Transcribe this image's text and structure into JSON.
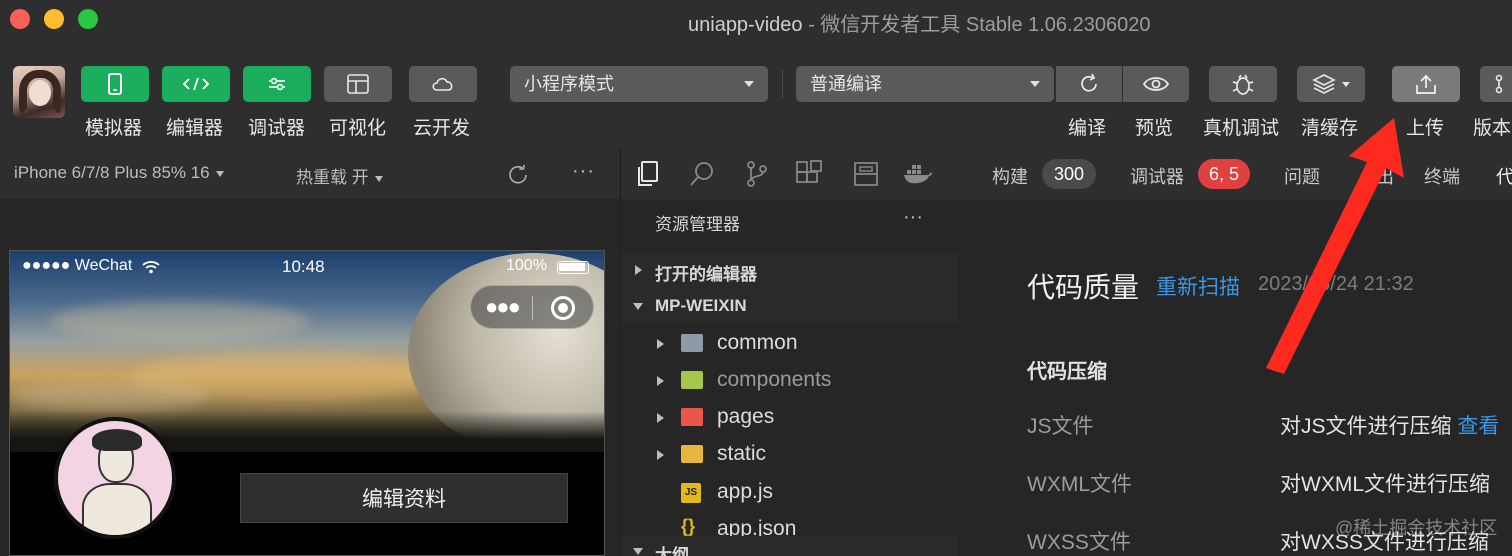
{
  "window": {
    "title_app": "uniapp-video",
    "title_rest": " - 微信开发者工具 Stable 1.06.2306020"
  },
  "toolbar": {
    "simulator": "模拟器",
    "editor": "编辑器",
    "debugger": "调试器",
    "visual": "可视化",
    "cloud": "云开发",
    "mode_select": "小程序模式",
    "compile_select": "普通编译",
    "compile": "编译",
    "preview": "预览",
    "real_debug": "真机调试",
    "clear_cache": "清缓存",
    "upload": "上传",
    "version": "版本"
  },
  "sim_bar": {
    "device": "iPhone 6/7/8 Plus 85% 16",
    "hot_reload": "热重载 开",
    "more": "···"
  },
  "phone": {
    "signal": "●●●●● WeChat",
    "time": "10:48",
    "battery": "100%",
    "edit_profile": "编辑资料"
  },
  "explorer": {
    "header": "资源管理器",
    "more": "···",
    "open_editors": "打开的编辑器",
    "project": "MP-WEIXIN",
    "files": [
      "common",
      "components",
      "pages",
      "static",
      "app.js",
      "app.json"
    ],
    "outline": "大纲"
  },
  "right_tabs": {
    "build": "构建",
    "build_count": "300",
    "debugger": "调试器",
    "debugger_count": "6, 5",
    "issues": "问题",
    "output": "出",
    "terminal": "终端",
    "code": "代"
  },
  "quality": {
    "title": "代码质量",
    "rescan": "重新扫描",
    "date": "2023/06/24 21:32",
    "section": "代码压缩",
    "rows": [
      {
        "key": "JS文件",
        "value": "对JS文件进行压缩",
        "link": "查看"
      },
      {
        "key": "WXML文件",
        "value": "对WXML文件进行压缩",
        "link": ""
      },
      {
        "key": "WXSS文件",
        "value": "对WXSS文件进行压缩",
        "link": ""
      }
    ]
  },
  "watermark": "@稀土掘金技术社区",
  "colors": {
    "green_button": "#1aad5c",
    "link_blue": "#3b95e8",
    "badge_red": "#e0403f",
    "annotation_arrow": "#ff2a1f"
  }
}
